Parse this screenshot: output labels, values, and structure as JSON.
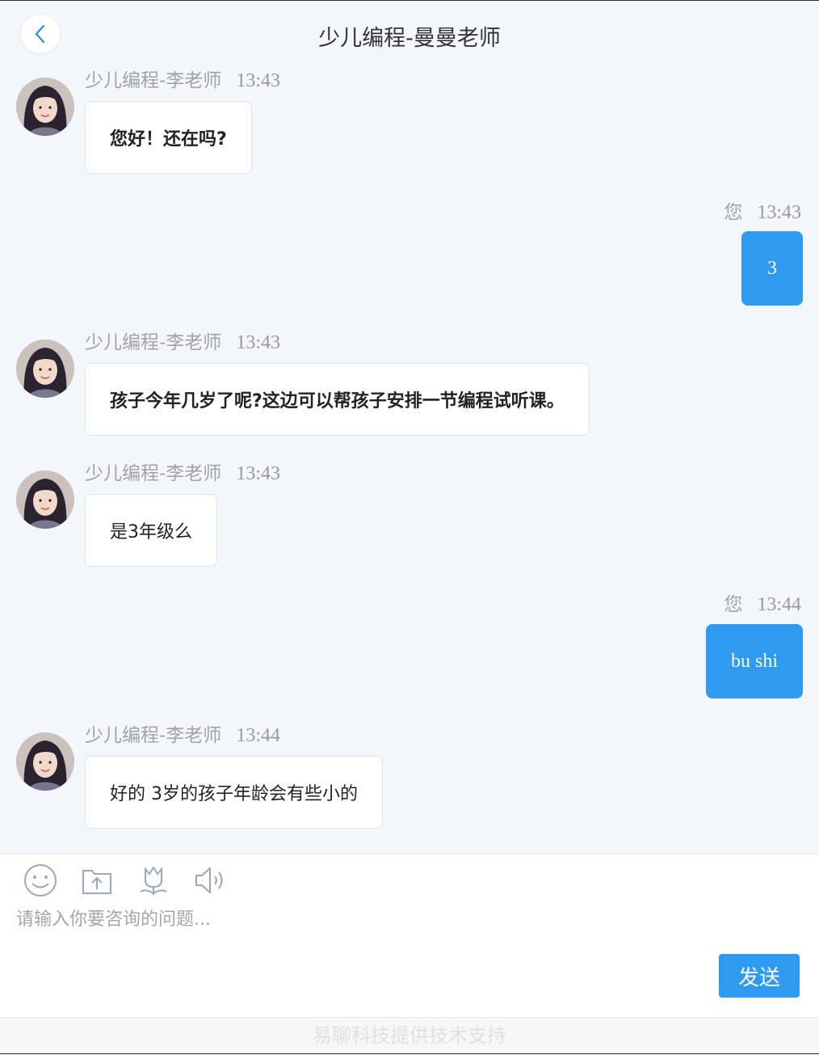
{
  "header": {
    "title": "少儿编程-曼曼老师",
    "back_icon": "chevron-left-icon"
  },
  "messages": [
    {
      "direction": "in",
      "sender": "少儿编程-李老师",
      "time": "13:43",
      "text": "您好！还在吗?"
    },
    {
      "direction": "out",
      "sender": "您",
      "time": "13:43",
      "text": "3"
    },
    {
      "direction": "in",
      "sender": "少儿编程-李老师",
      "time": "13:43",
      "text": "孩子今年几岁了呢?这边可以帮孩子安排一节编程试听课。"
    },
    {
      "direction": "in",
      "sender": "少儿编程-李老师",
      "time": "13:43",
      "text": "是3年级么"
    },
    {
      "direction": "out",
      "sender": "您",
      "time": "13:44",
      "text": "bu shi"
    },
    {
      "direction": "in",
      "sender": "少儿编程-李老师",
      "time": "13:44",
      "text": "好的 3岁的孩子年龄会有些小的"
    }
  ],
  "composer": {
    "tools": [
      "emoji-icon",
      "upload-file-icon",
      "flower-icon",
      "voice-icon"
    ],
    "placeholder": "请输入你要咨询的问题...",
    "send_label": "发送"
  },
  "footer": {
    "text": "易聊科技提供技术支持"
  },
  "colors": {
    "accent": "#2e9af0",
    "background": "#f3f6fa",
    "bubble_in": "#ffffff"
  }
}
